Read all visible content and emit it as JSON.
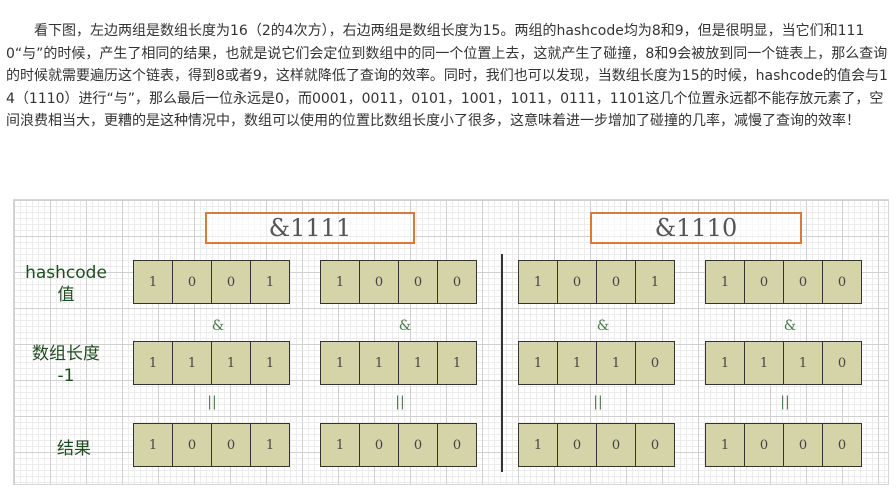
{
  "paragraph": "看下图，左边两组是数组长度为16（2的4次方），右边两组是数组长度为15。两组的hashcode均为8和9，但是很明显，当它们和1110“与”的时候，产生了相同的结果，也就是说它们会定位到数组中的同一个位置上去，这就产生了碰撞，8和9会被放到同一个链表上，那么查询的时候就需要遍历这个链表，得到8或者9，这样就降低了查询的效率。同时，我们也可以发现，当数组长度为15的时候，hashcode的值会与14（1110）进行“与”，那么最后一位永远是0，而0001，0011，0101，1001，1011，0111，1101这几个位置永远都不能存放元素了，空间浪费相当大，更糟的是这种情况中，数组可以使用的位置比数组长度小了很多，这意味着进一步增加了碰撞的几率，减慢了查询的效率！",
  "figure": {
    "left_title": "&1111",
    "right_title": "&1110",
    "row_labels": {
      "hashcode_line1": "hashcode",
      "hashcode_line2": "值",
      "length_line1": "数组长度",
      "length_line2": "-1",
      "result": "结果"
    },
    "and_symbol": "&",
    "equals_symbol": "||",
    "groups": [
      {
        "hashcode": [
          "1",
          "0",
          "0",
          "1"
        ],
        "mask": [
          "1",
          "1",
          "1",
          "1"
        ],
        "result": [
          "1",
          "0",
          "0",
          "1"
        ]
      },
      {
        "hashcode": [
          "1",
          "0",
          "0",
          "0"
        ],
        "mask": [
          "1",
          "1",
          "1",
          "1"
        ],
        "result": [
          "1",
          "0",
          "0",
          "0"
        ]
      },
      {
        "hashcode": [
          "1",
          "0",
          "0",
          "1"
        ],
        "mask": [
          "1",
          "1",
          "1",
          "0"
        ],
        "result": [
          "1",
          "0",
          "0",
          "0"
        ]
      },
      {
        "hashcode": [
          "1",
          "0",
          "0",
          "0"
        ],
        "mask": [
          "1",
          "1",
          "1",
          "0"
        ],
        "result": [
          "1",
          "0",
          "0",
          "0"
        ]
      }
    ]
  }
}
